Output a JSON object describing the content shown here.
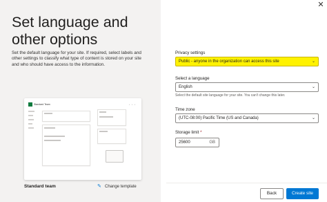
{
  "header": {
    "title": "Set language and other options",
    "description": "Set the default language for your site. If required, select labels and other settings to classify what type of content is stored on your site and who should have access to the information."
  },
  "template": {
    "preview_title": "Standard Team",
    "name": "Standard team",
    "change_label": "Change template"
  },
  "form": {
    "privacy": {
      "label": "Privacy settings",
      "value": "Public - anyone in the organization can access this site"
    },
    "language": {
      "label": "Select a language",
      "value": "English",
      "helper": "Select the default site language for your site. You can't change this later."
    },
    "timezone": {
      "label": "Time zone",
      "value": "(UTC-08:00) Pacific Time (US and Canada)"
    },
    "storage": {
      "label": "Storage limit",
      "required_mark": "*",
      "value": "25600",
      "unit": "GB"
    }
  },
  "footer": {
    "back_label": "Back",
    "create_label": "Create site"
  },
  "colors": {
    "accent": "#0078d4",
    "highlight": "#fff200",
    "panel_bg": "#f3f2f1"
  }
}
